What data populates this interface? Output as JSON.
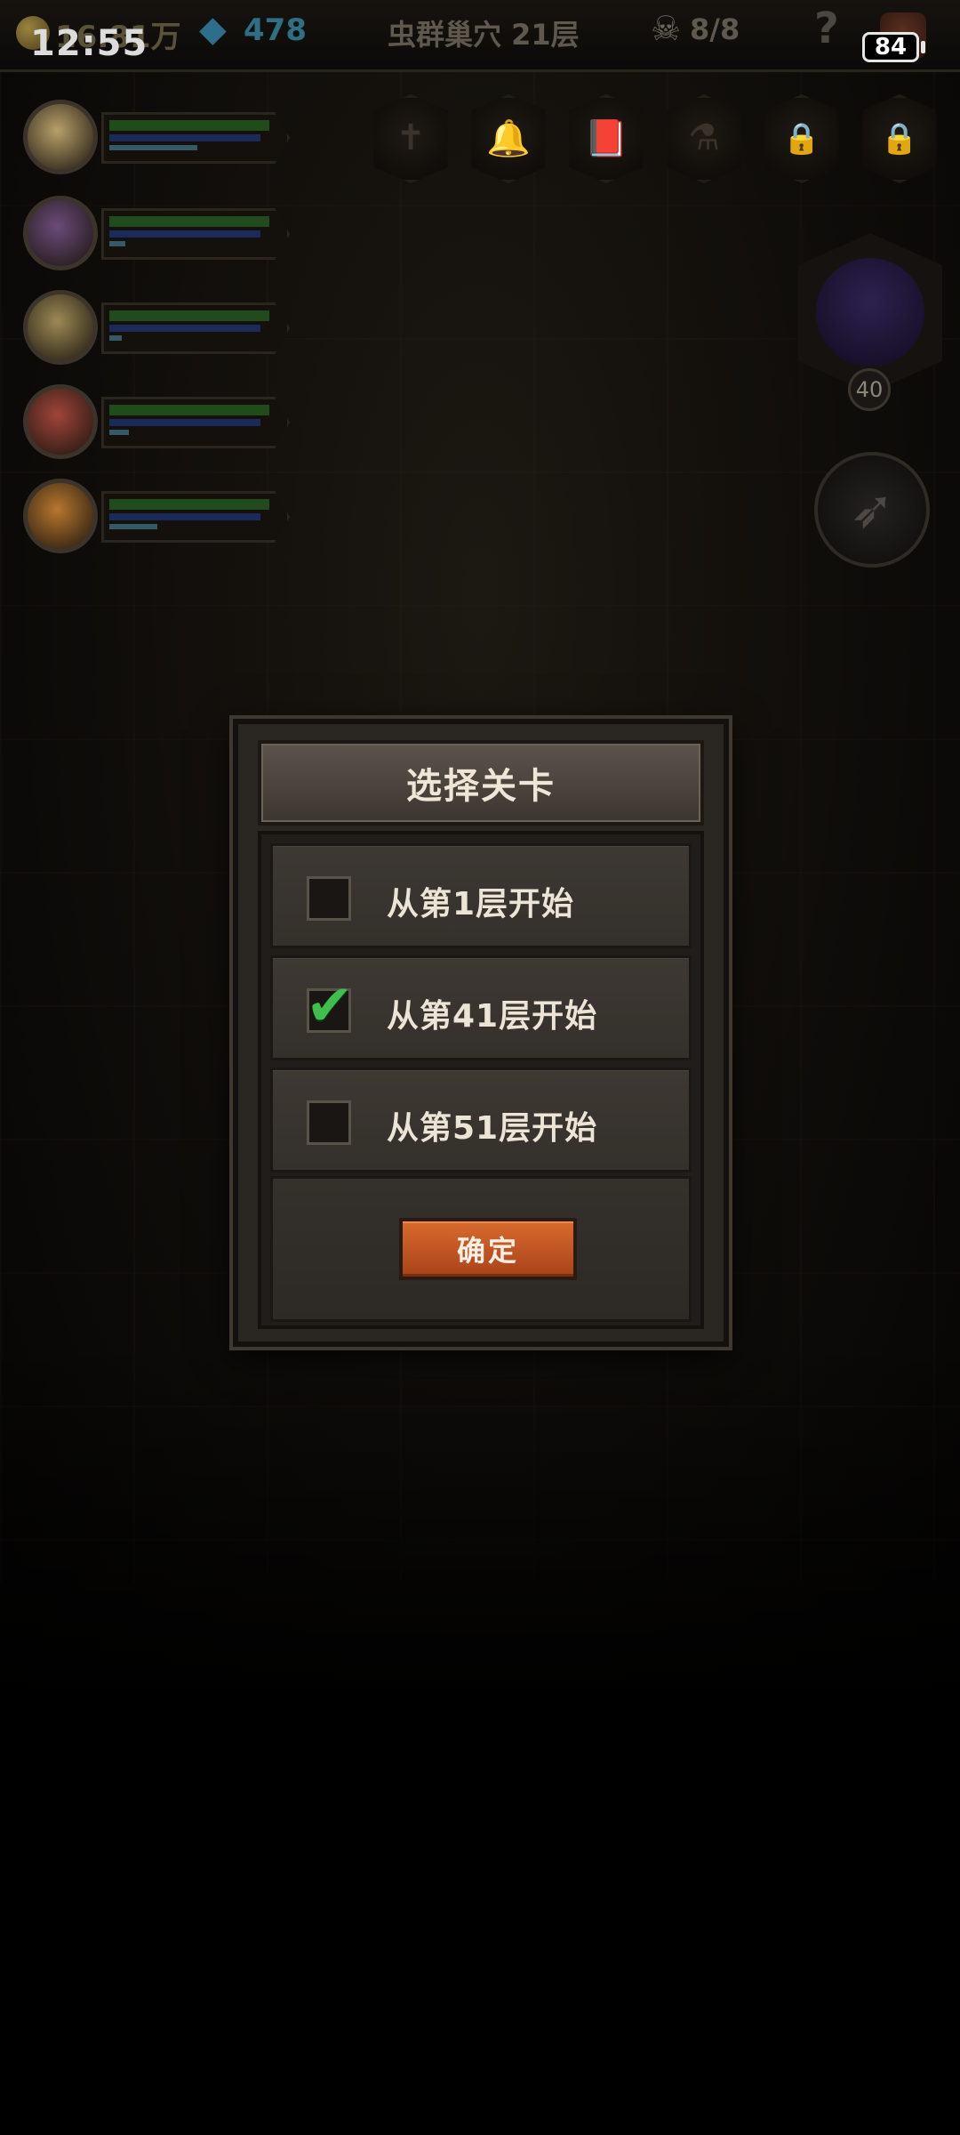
{
  "status_bar": {
    "time": "12:55",
    "battery": "84"
  },
  "hud": {
    "gold": "16.81万",
    "gems": "478",
    "floor_title": "虫群巢穴 21层",
    "kills": "8/8",
    "help_symbol": "?"
  },
  "heroes": [
    {
      "name": "hero-1",
      "avatar_color": "#b8a06a",
      "xp_fraction": 0.55
    },
    {
      "name": "hero-2",
      "avatar_color": "#6b4b7a",
      "xp_fraction": 0.1
    },
    {
      "name": "hero-3",
      "avatar_color": "#9c8a55",
      "xp_fraction": 0.08
    },
    {
      "name": "hero-4",
      "avatar_color": "#a0453a",
      "xp_fraction": 0.12
    },
    {
      "name": "hero-5",
      "avatar_color": "#b9772e",
      "xp_fraction": 0.3
    }
  ],
  "skill_slots": [
    {
      "icon": "cross-icon",
      "glyph": "✝",
      "locked": false
    },
    {
      "icon": "bell-icon",
      "glyph": "🔔",
      "locked": false
    },
    {
      "icon": "book-icon",
      "glyph": "📕",
      "locked": false
    },
    {
      "icon": "potion-icon",
      "glyph": "⚗",
      "locked": false
    },
    {
      "icon": "lock-icon",
      "glyph": "🔒",
      "locked": true
    },
    {
      "icon": "lock-icon",
      "glyph": "🔒",
      "locked": true
    }
  ],
  "boss": {
    "level": "40"
  },
  "dialog": {
    "title": "选择关卡",
    "options": [
      {
        "label": "从第1层开始",
        "checked": false
      },
      {
        "label": "从第41层开始",
        "checked": true
      },
      {
        "label": "从第51层开始",
        "checked": false
      }
    ],
    "confirm_label": "确定",
    "check_glyph": "✔"
  },
  "colors": {
    "accent_button": "#c3582a",
    "check_green": "#3fbe4e"
  }
}
